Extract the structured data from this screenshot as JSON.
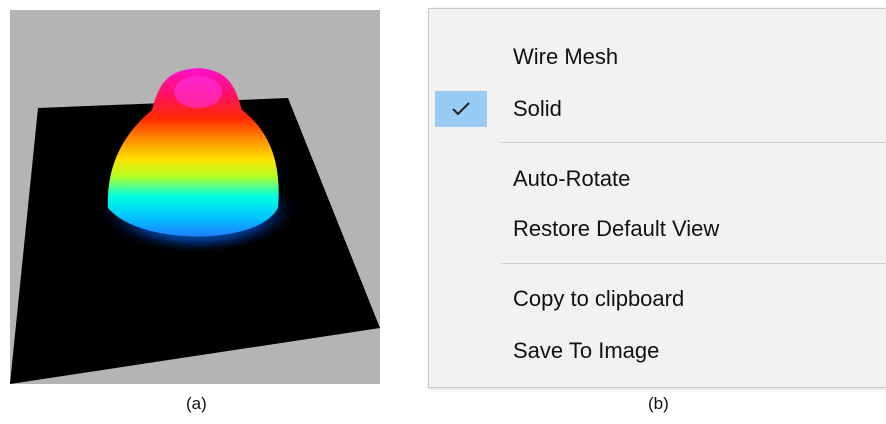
{
  "figure": {
    "caption_a": "(a)",
    "caption_b": "(b)"
  },
  "plot": {
    "icon": "3d-beam-surface",
    "colormap": [
      "#000060",
      "#00bfff",
      "#00ffd0",
      "#ffff00",
      "#ff8c00",
      "#ff2000",
      "#ff00c8"
    ],
    "background": "#b4b4b4",
    "plane_color": "#000000"
  },
  "context_menu": {
    "items": [
      {
        "label": "Wire Mesh",
        "checked": false
      },
      {
        "label": "Solid",
        "checked": true
      },
      {
        "label": "Auto-Rotate",
        "checked": false
      },
      {
        "label": "Restore Default View",
        "checked": false
      },
      {
        "label": "Copy to clipboard",
        "checked": false
      },
      {
        "label": "Save To Image",
        "checked": false
      }
    ],
    "check_highlight_color": "#99ccf5",
    "check_icon": "checkmark-icon"
  }
}
